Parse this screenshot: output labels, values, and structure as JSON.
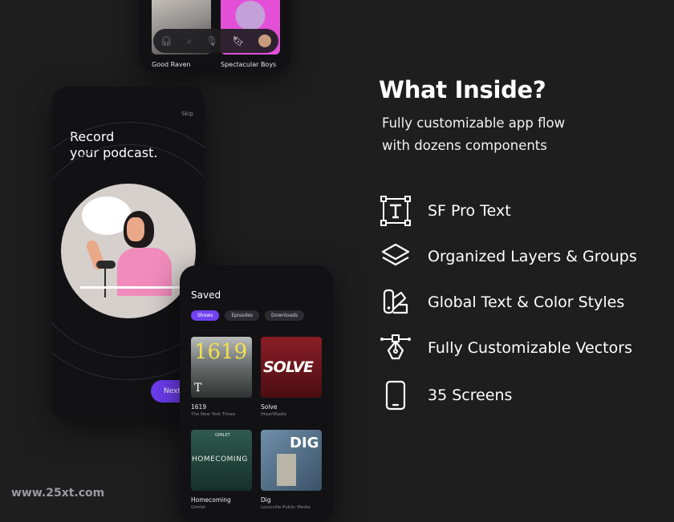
{
  "top_phone": {
    "items": [
      {
        "title": "Good Raven"
      },
      {
        "title": "Spectacular Boys"
      }
    ],
    "tab_icons": [
      "headphones-icon",
      "search-icon",
      "mic-icon",
      "bookmark-icon",
      "avatar"
    ]
  },
  "onboarding": {
    "skip_label": "Skip",
    "title": "Record\nyour podcast.",
    "next_label": "Next"
  },
  "saved": {
    "title": "Saved",
    "tabs": [
      {
        "label": "Shows",
        "active": true
      },
      {
        "label": "Episodes",
        "active": false
      },
      {
        "label": "Downloads",
        "active": false
      }
    ],
    "podcasts": [
      {
        "cover_text": "1619",
        "cover_mark": "T",
        "title": "1619",
        "publisher": "The New York Times"
      },
      {
        "cover_text": "SOLVE",
        "title": "Solve",
        "publisher": "iHeartRadio"
      },
      {
        "cover_text": "HOMECOMING",
        "cover_mark": "GIMLET",
        "title": "Homecoming",
        "publisher": "Gimlet"
      },
      {
        "cover_text": "DIG",
        "title": "Dig",
        "publisher": "Louisville Public Media"
      }
    ]
  },
  "info": {
    "heading": "What Inside?",
    "subtitle_line1": "Fully customizable app flow",
    "subtitle_line2": "with dozens components",
    "features": [
      {
        "icon": "text-tool-icon",
        "label": "SF Pro Text"
      },
      {
        "icon": "layers-icon",
        "label": "Organized Layers & Groups"
      },
      {
        "icon": "swatch-icon",
        "label": "Global Text & Color Styles"
      },
      {
        "icon": "pen-tool-icon",
        "label": "Fully Customizable Vectors"
      },
      {
        "icon": "phone-icon",
        "label": "35 Screens"
      }
    ]
  },
  "watermark": "www.25xt.com",
  "colors": {
    "accent": "#7242f2",
    "background": "#1e1e1f",
    "phone": "#121214"
  }
}
